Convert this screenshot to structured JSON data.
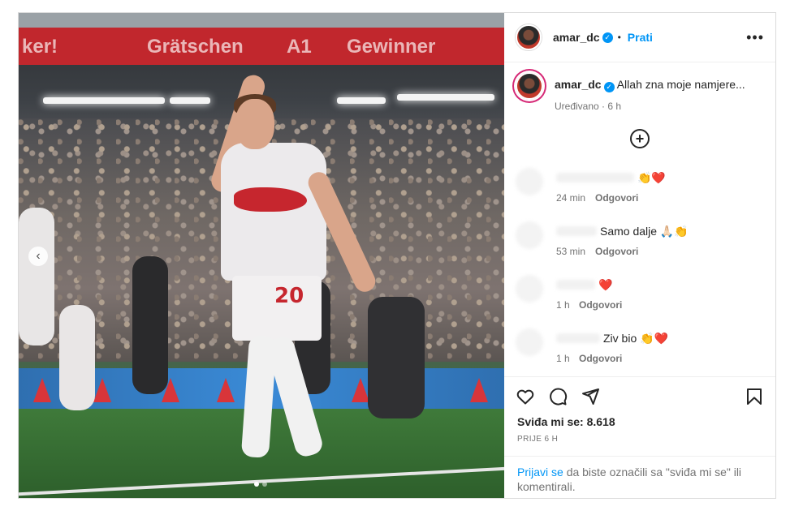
{
  "media": {
    "banner_words": [
      "ker!",
      "Grätschen",
      "A1",
      "Gewinner"
    ],
    "player_number": "20",
    "prev_arrow": "‹",
    "carousel_dots": 2,
    "carousel_active": 0
  },
  "header": {
    "username": "amar_dc",
    "verified": "✓",
    "separator": "•",
    "follow_label": "Prati",
    "more_label": "•••"
  },
  "caption": {
    "username": "amar_dc",
    "verified": "✓",
    "text": "Allah zna moje namjere...",
    "edited": "Uređivano",
    "dot": "·",
    "time": "6 h"
  },
  "add_comment_icon": "+",
  "comments": [
    {
      "text": "👏❤️",
      "time": "24 min",
      "reply": "Odgovori"
    },
    {
      "text": "Samo dalje 🙏🏻👏",
      "time": "53 min",
      "reply": "Odgovori"
    },
    {
      "text": "❤️",
      "time": "1 h",
      "reply": "Odgovori"
    },
    {
      "text": "Ziv bio 👏❤️",
      "time": "1 h",
      "reply": "Odgovori"
    }
  ],
  "actions": {
    "icons": [
      "heart-icon",
      "comment-icon",
      "share-icon",
      "bookmark-icon"
    ]
  },
  "likes": {
    "label": "Sviđa mi se:",
    "count": "8.618"
  },
  "posted_ago": "PRIJE 6 H",
  "login": {
    "link": "Prijavi se",
    "rest": "da biste označili sa \"sviđa mi se\" ili komentirali."
  }
}
